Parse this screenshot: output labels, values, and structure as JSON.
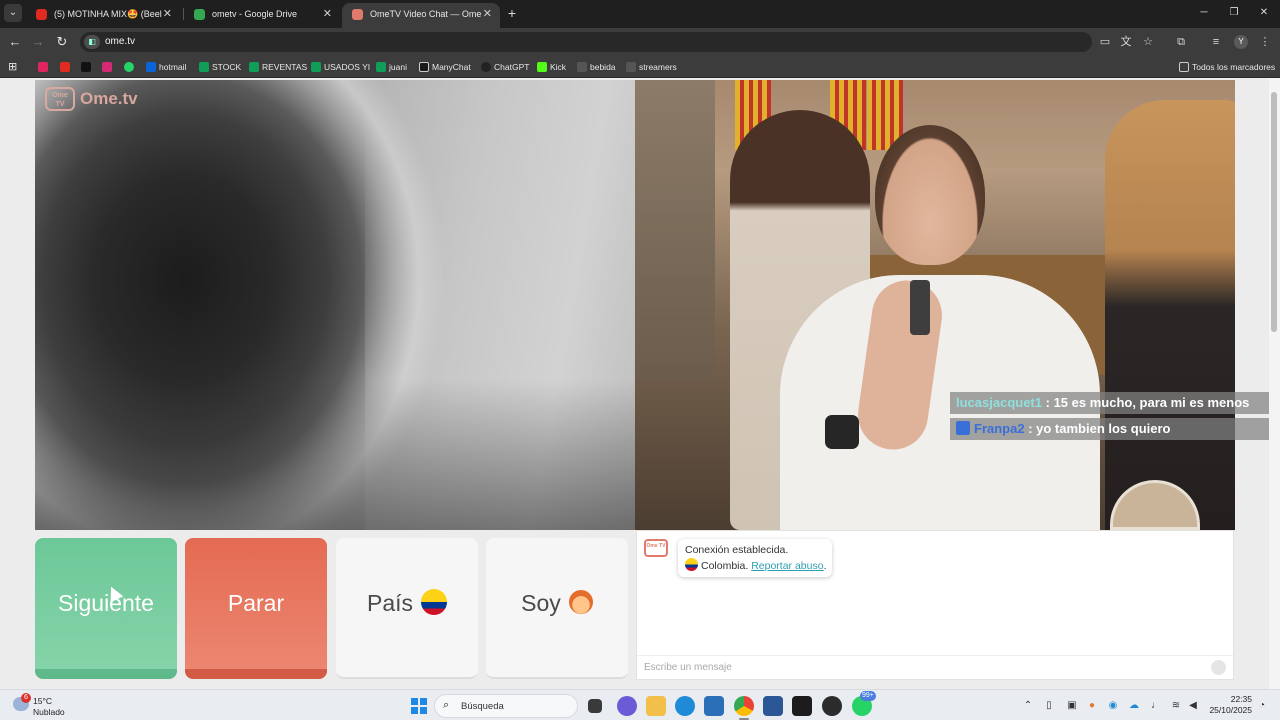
{
  "browser": {
    "tabs": [
      {
        "title": "(5) MOTINHA MIX🤩 (Beel",
        "favicon_color": "#e02b20"
      },
      {
        "title": "ometv - Google Drive",
        "favicon_color": "#34a853"
      },
      {
        "title": "OmeTV Video Chat — Ome",
        "favicon_color": "#e07a6a"
      }
    ],
    "url": "ome.tv",
    "bookmarks": [
      {
        "label": "",
        "icon_color": "#e0245e"
      },
      {
        "label": "",
        "icon_color": "#e02b20"
      },
      {
        "label": "",
        "icon_color": "#111111"
      },
      {
        "label": "",
        "icon_color": "#25d366"
      },
      {
        "label": "",
        "icon_color": "#d62976"
      },
      {
        "label": "hotmail",
        "icon_color": "#0a64d8"
      },
      {
        "label": "STOCK",
        "icon_color": "#0f9d58"
      },
      {
        "label": "REVENTAS",
        "icon_color": "#0f9d58"
      },
      {
        "label": "USADOS YI",
        "icon_color": "#0f9d58"
      },
      {
        "label": "juani",
        "icon_color": "#0f9d58"
      },
      {
        "label": "ManyChat",
        "icon_color": "#1a1a1a"
      },
      {
        "label": "ChatGPT",
        "icon_color": "#222222"
      },
      {
        "label": "Kick",
        "icon_color": "#53fc18"
      },
      {
        "label": "bebida",
        "icon_color": "#555555"
      },
      {
        "label": "streamers",
        "icon_color": "#555555"
      }
    ],
    "all_bookmarks": "Todos los marcadores",
    "profile_initial": "Y"
  },
  "page": {
    "logo_text": "Ome.tv",
    "logo_badge": "Ome TV",
    "stream_chat": [
      {
        "user": "lucasjacquet1",
        "message": ": 15 es mucho, para mi es menos"
      },
      {
        "user": "Franpa2",
        "message": ": yo tambien los quiero"
      }
    ],
    "buttons": {
      "next": "Siguiente",
      "stop": "Parar",
      "country": "País",
      "gender": "Soy"
    },
    "chat": {
      "status": "Conexión establecida.",
      "country": "Colombia.",
      "report": "Reportar abuso",
      "report_suffix": ".",
      "placeholder": "Escribe un mensaje"
    }
  },
  "taskbar": {
    "weather_temp": "15°C",
    "weather_desc": "Nublado",
    "weather_alerts": "6",
    "search_label": "Búsqueda",
    "whatsapp_badge": "99+",
    "time": "22:35",
    "date": "25/10/2025"
  }
}
